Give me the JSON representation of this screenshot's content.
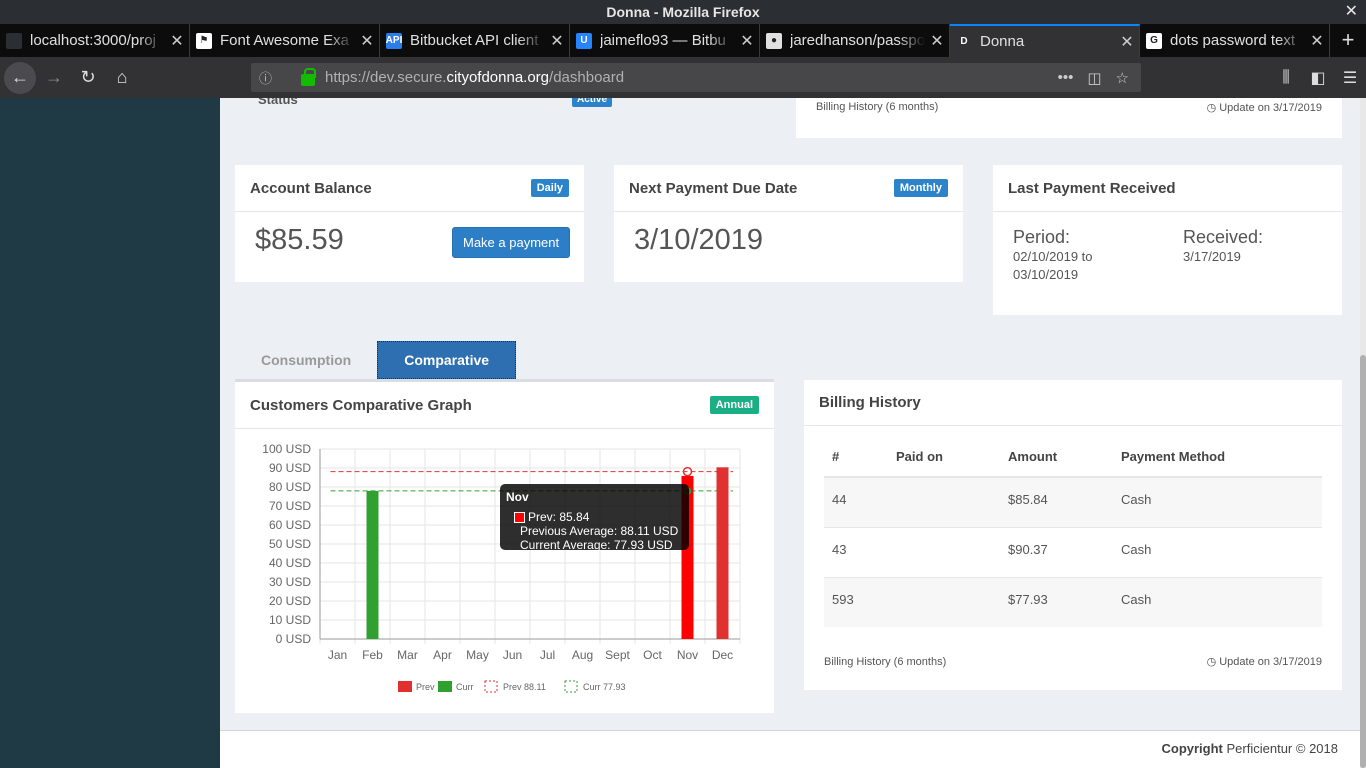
{
  "window": {
    "title": "Donna - Mozilla Firefox"
  },
  "browser": {
    "tabs": [
      {
        "title": "localhost:3000/proj",
        "favicon_color": "#2b2e33",
        "favicon_glyph": ""
      },
      {
        "title": "Font Awesome Exa",
        "favicon_color": "#ffffff",
        "favicon_glyph": "⚑"
      },
      {
        "title": "Bitbucket API client",
        "favicon_color": "#2b7de9",
        "favicon_glyph": "API"
      },
      {
        "title": "jaimeflo93 — Bitbu",
        "favicon_color": "#2684ff",
        "favicon_glyph": "U"
      },
      {
        "title": "jaredhanson/passpo",
        "favicon_color": "#e0e0e0",
        "favicon_glyph": "●"
      },
      {
        "title": "Donna",
        "favicon_color": "#323234",
        "favicon_glyph": "D"
      },
      {
        "title": "dots password text",
        "favicon_color": "#ffffff",
        "favicon_glyph": "G"
      }
    ],
    "new_tab_glyph": "+",
    "url_prefix": "https://dev.secure.",
    "url_domain": "cityofdonna.org",
    "url_path": "/dashboard"
  },
  "top_section": {
    "status_label": "Status",
    "status_badge": "Active",
    "billing_note": "Billing History (6 months)",
    "update_note": "Update on 3/17/2019"
  },
  "account_balance": {
    "title": "Account Balance",
    "badge": "Daily",
    "value": "$85.59",
    "button": "Make a payment"
  },
  "next_payment": {
    "title": "Next Payment Due Date",
    "badge": "Monthly",
    "value": "3/10/2019"
  },
  "last_payment": {
    "title": "Last Payment Received",
    "period_label": "Period:",
    "period_value_1": "02/10/2019 to",
    "period_value_2": "03/10/2019",
    "received_label": "Received:",
    "received_value": "3/17/2019"
  },
  "tabs": {
    "consumption": "Consumption",
    "comparative": "Comparative"
  },
  "graph": {
    "title": "Customers Comparative Graph",
    "badge": "Annual",
    "tooltip": {
      "title": "Nov",
      "line1": "Prev: 85.84",
      "line2": "Previous Average: 88.11 USD",
      "line3": "Current Average: 77.93 USD"
    }
  },
  "chart_data": {
    "type": "bar",
    "categories": [
      "Jan",
      "Feb",
      "Mar",
      "Apr",
      "May",
      "Jun",
      "Jul",
      "Aug",
      "Sept",
      "Oct",
      "Nov",
      "Dec"
    ],
    "series": [
      {
        "name": "Prev",
        "color": "#e03030",
        "values": [
          null,
          null,
          null,
          null,
          null,
          null,
          null,
          null,
          null,
          null,
          85.84,
          90.37
        ]
      },
      {
        "name": "Curr",
        "color": "#30a030",
        "values": [
          null,
          77.93,
          null,
          null,
          null,
          null,
          null,
          null,
          null,
          null,
          null,
          null
        ]
      }
    ],
    "reference_lines": [
      {
        "name": "Prev 88.11",
        "value": 88.11,
        "color": "#e03030"
      },
      {
        "name": "Curr 77.93",
        "value": 77.93,
        "color": "#30a030"
      }
    ],
    "y_ticks": [
      "0 USD",
      "10 USD",
      "20 USD",
      "30 USD",
      "40 USD",
      "50 USD",
      "60 USD",
      "70 USD",
      "80 USD",
      "90 USD",
      "100 USD"
    ],
    "ylim": [
      0,
      100
    ],
    "grid": true,
    "legend_position": "bottom",
    "highlight": {
      "category": "Nov",
      "color": "#ff0000"
    }
  },
  "billing_history": {
    "title": "Billing History",
    "columns": [
      "#",
      "Paid on",
      "Amount",
      "Payment Method"
    ],
    "rows": [
      {
        "num": "44",
        "paid_on": "",
        "amount": "$85.84",
        "method": "Cash"
      },
      {
        "num": "43",
        "paid_on": "",
        "amount": "$90.37",
        "method": "Cash"
      },
      {
        "num": "593",
        "paid_on": "",
        "amount": "$77.93",
        "method": "Cash"
      }
    ],
    "footer_left": "Billing History (6 months)",
    "footer_right": "Update on 3/17/2019"
  },
  "footer": {
    "label": "Copyright",
    "text": "Perficientur © 2018"
  }
}
